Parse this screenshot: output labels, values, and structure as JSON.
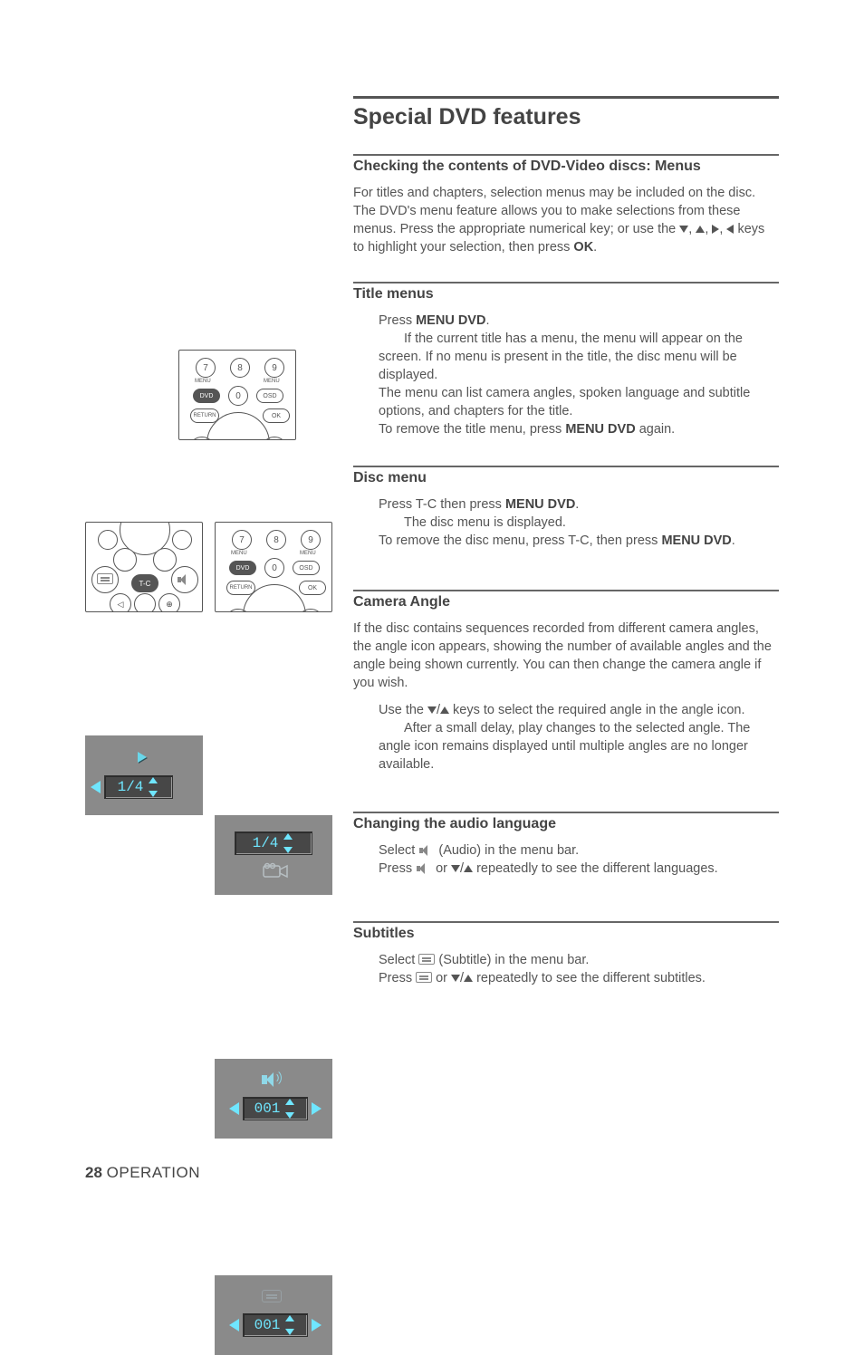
{
  "page": {
    "number": "28",
    "section_label": "OPERATION"
  },
  "title": "Special DVD features",
  "sections": {
    "checking": {
      "heading": "Checking the contents of DVD-Video discs: Menus",
      "p1a": "For titles and chapters, selection menus may be included on the disc.   The DVD's menu feature allows you to make selections from these menus. Press the appropriate numerical key; or use the ",
      "p1b": " keys to highlight your selection, then press ",
      "ok": "OK",
      "p1c": "."
    },
    "title_menus": {
      "heading": "Title menus",
      "l1a": "Press ",
      "l1b": "MENU DVD",
      "l1c": ".",
      "l2": "If the current title has a menu, the menu will appear on the screen. If no menu is present in the title, the disc menu will be displayed.",
      "l3": "The menu can list camera angles, spoken language and subtitle options, and chapters for the title.",
      "l4a": "To remove the title menu, press ",
      "l4b": "MENU DVD",
      "l4c": " again."
    },
    "disc_menu": {
      "heading": "Disc menu",
      "l1a": "Press T-C then press ",
      "l1b": "MENU DVD",
      "l1c": ".",
      "l2": "The disc menu is displayed.",
      "l3a": "To remove the disc menu, press T-C, then press ",
      "l3b": "MENU DVD",
      "l3c": "."
    },
    "camera": {
      "heading": "Camera Angle",
      "p1": "If the disc contains sequences recorded from different camera angles, the angle icon appears, showing the number of available angles and the angle being shown currently. You can then change the camera angle if you wish.",
      "l1a": "Use the ",
      "l1b": " keys to select the required angle in the angle icon.",
      "l2": "After a small delay, play changes to the selected angle. The angle icon remains displayed until multiple angles are no longer available."
    },
    "audio": {
      "heading": "Changing the audio language",
      "l1a": "Select ",
      "l1b": " (Audio) in the menu bar.",
      "l2a": "Press ",
      "l2b": " or ",
      "l2c": " repeatedly to see the different languages."
    },
    "subtitles": {
      "heading": "Subtitles",
      "l1a": "Select ",
      "l1b": " (Subtitle) in the menu bar.",
      "l2a": "Press ",
      "l2b": " or ",
      "l2c": " repeatedly to see the different subtitles."
    }
  },
  "illus": {
    "remote_labels": {
      "n7": "7",
      "n8": "8",
      "n9": "9",
      "n0": "0",
      "menu": "MENU",
      "dvd": "DVD",
      "osd": "OSD",
      "return": "RETURN",
      "ok": "OK",
      "tc": "T-C"
    },
    "osd": {
      "angle_small": "1/4",
      "angle_big": "1/4",
      "audio": "001",
      "sub": "001"
    }
  }
}
